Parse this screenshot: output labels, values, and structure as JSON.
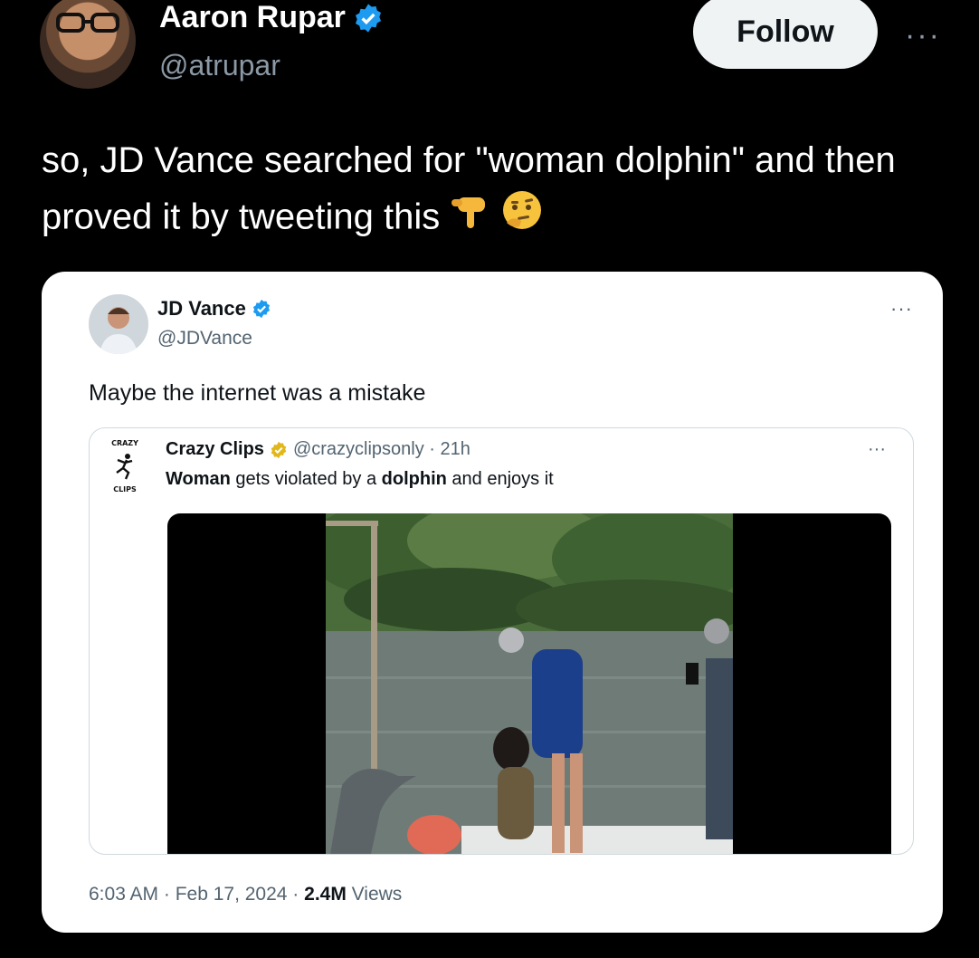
{
  "author": {
    "name": "Aaron Rupar",
    "handle": "@atrupar",
    "verified": true,
    "follow_label": "Follow",
    "more_label": "···"
  },
  "tweet": {
    "text": "so, JD Vance searched for \"woman dolphin\" and then proved it by tweeting this",
    "emojis": [
      "backhand-index-pointing-down",
      "thinking-face"
    ]
  },
  "embedded": {
    "name": "JD Vance",
    "handle": "@JDVance",
    "verified": true,
    "more_label": "···",
    "text": "Maybe the internet was a mistake",
    "quote": {
      "logo_top": "CRAZY",
      "logo_bottom": "CLIPS",
      "name": "Crazy Clips",
      "meta": "@crazyclipsonly · 21h",
      "more_label": "···",
      "text_parts": [
        "Woman",
        " gets violated by a ",
        "dolphin",
        " and enjoys it"
      ]
    },
    "timestamp": "6:03 AM · Feb 17, 2024 · ",
    "views_count": "2.4M",
    "views_label": " Views"
  },
  "colors": {
    "background": "#000000",
    "verified_blue": "#1d9bf0",
    "verified_gold": "#e2b719",
    "muted": "#536471"
  }
}
